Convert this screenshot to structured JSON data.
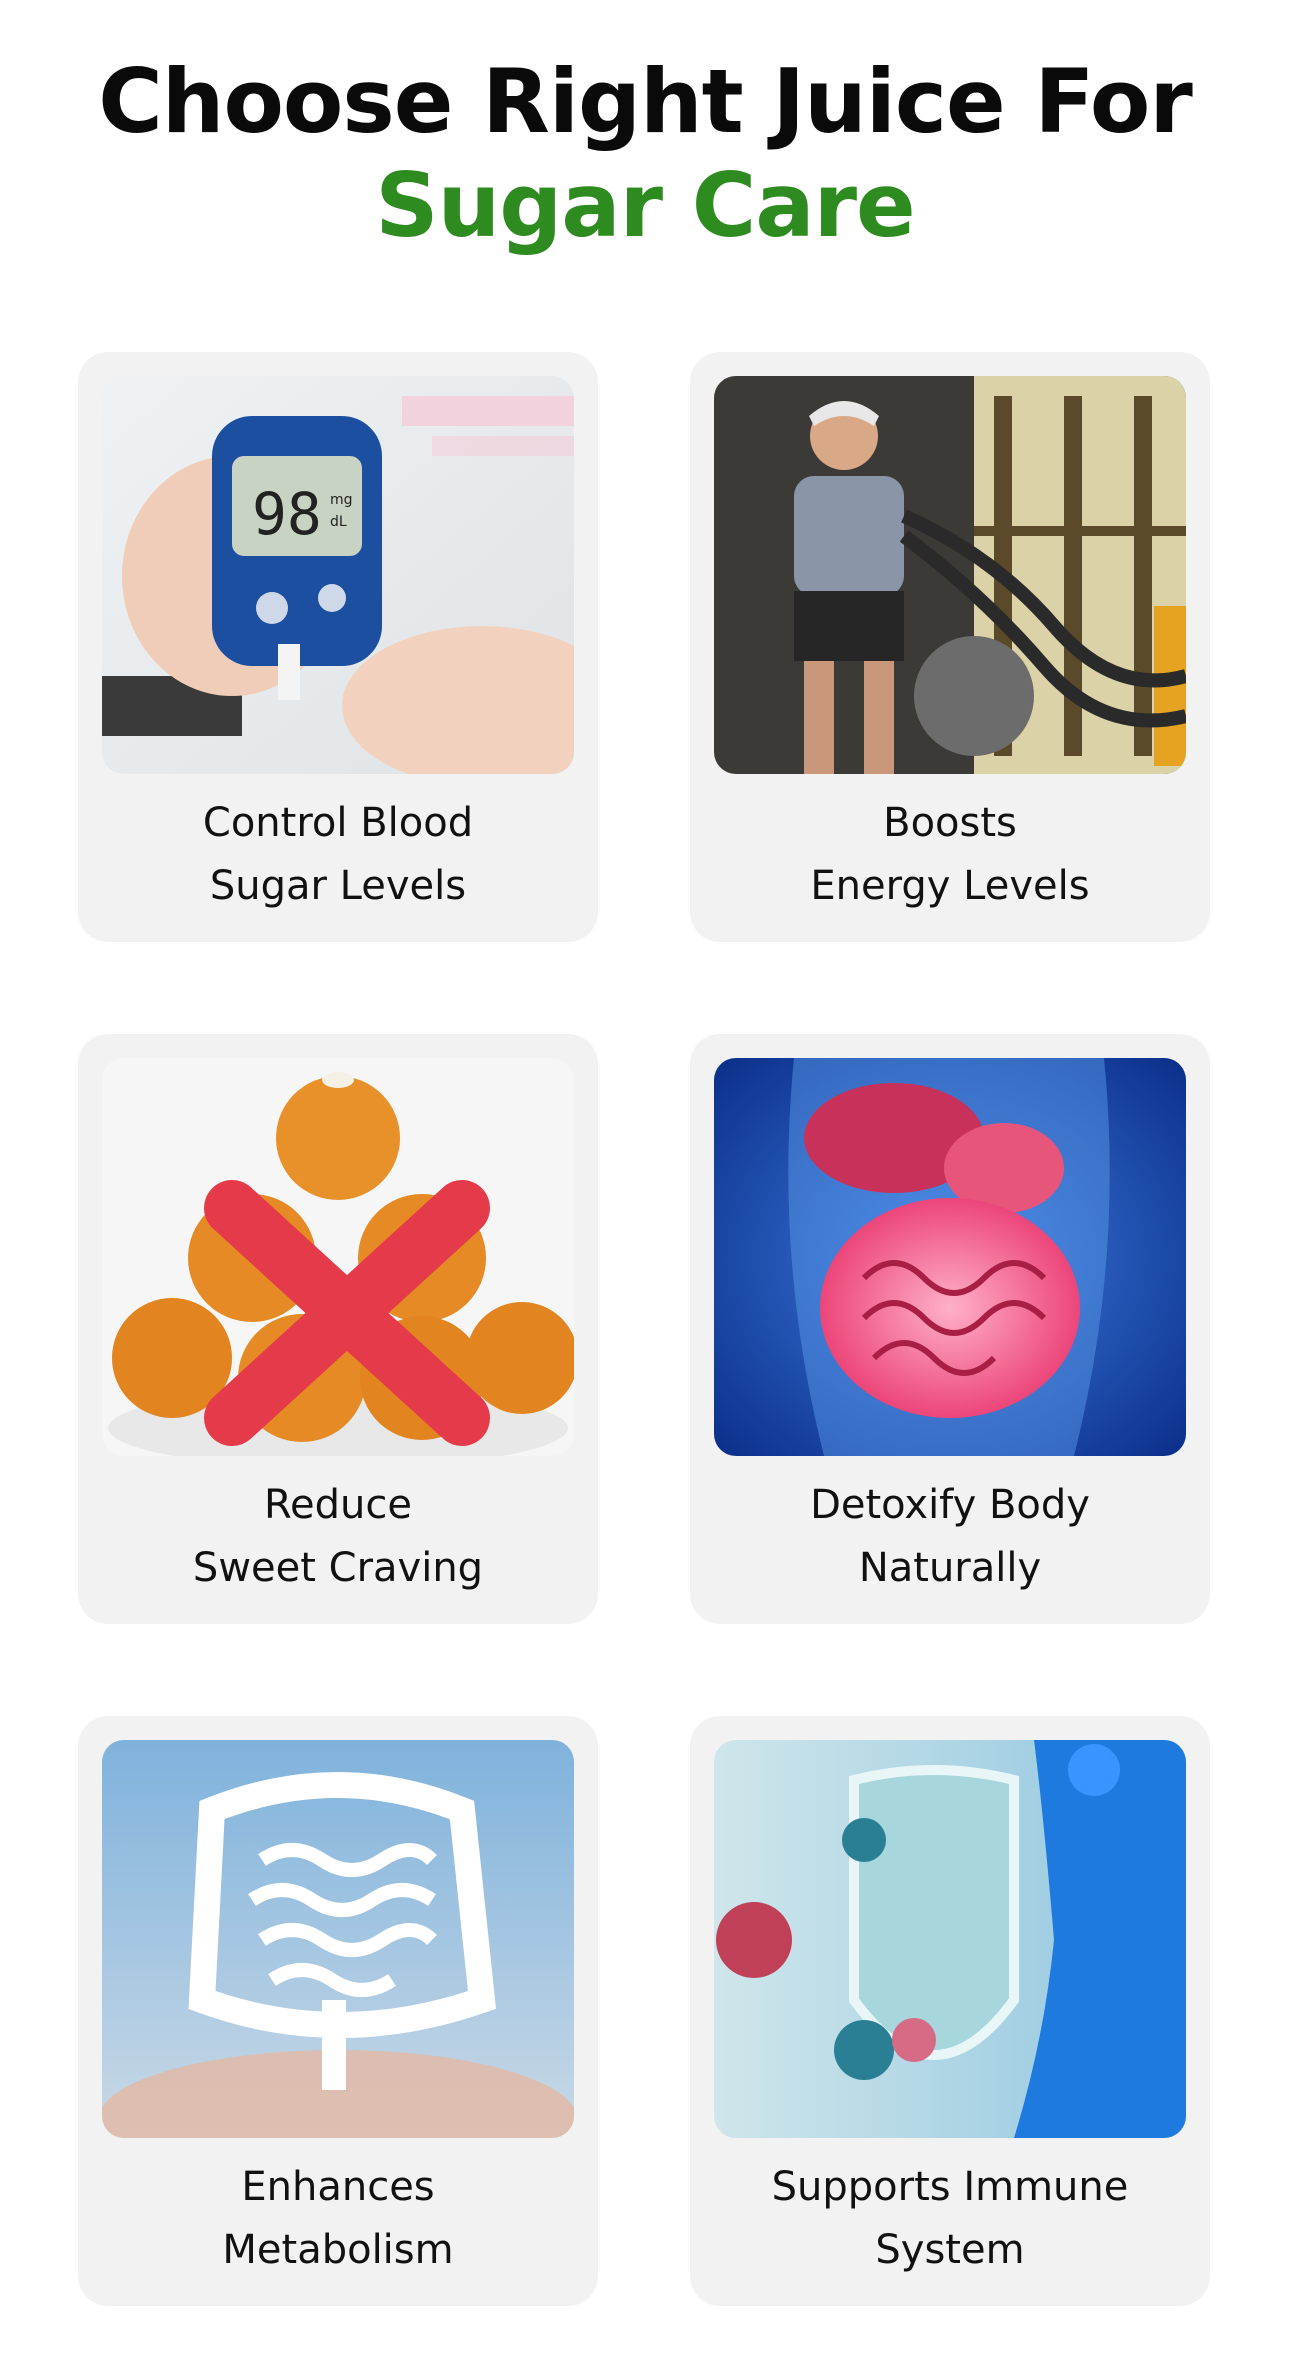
{
  "title": {
    "line1": "Choose Right Juice For",
    "line2": "Sugar Care"
  },
  "colors": {
    "title_dark": "#0a0a0a",
    "title_accent": "#2e8b1f",
    "card_bg": "#f2f2f2"
  },
  "cards": [
    {
      "icon": "glucometer-image",
      "reading": "98",
      "unit_top": "mg",
      "unit_bottom": "dL",
      "line1": "Control Blood",
      "line2": "Sugar Levels"
    },
    {
      "icon": "battle-ropes-workout-image",
      "line1": "Boosts",
      "line2": "Energy Levels"
    },
    {
      "icon": "crossed-out-sweets-image",
      "line1": "Reduce",
      "line2": "Sweet Craving"
    },
    {
      "icon": "digestive-system-image",
      "line1": "Detoxify Body",
      "line2": "Naturally"
    },
    {
      "icon": "intestine-illustration-image",
      "line1": "Enhances",
      "line2": "Metabolism"
    },
    {
      "icon": "immune-shield-image",
      "line1": "Supports Immune",
      "line2": "System"
    }
  ]
}
